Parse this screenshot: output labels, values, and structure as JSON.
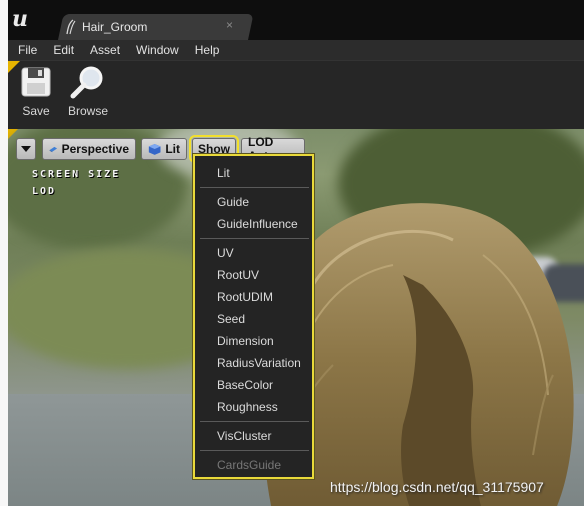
{
  "app": {
    "logo_icon": "unreal-logo-icon"
  },
  "tab": {
    "title": "Hair_Groom",
    "close_glyph": "×",
    "icon": "groom-asset-icon"
  },
  "menu": [
    "File",
    "Edit",
    "Asset",
    "Window",
    "Help"
  ],
  "toolbar": {
    "save_label": "Save",
    "browse_label": "Browse"
  },
  "viewport_toolbar": {
    "perspective_label": "Perspective",
    "lit_label": "Lit",
    "show_label": "Show",
    "lod_label": "LOD Auto"
  },
  "overlay": {
    "line1": "SCREEN SIZE",
    "line2": "LOD"
  },
  "show_menu": {
    "items": [
      "Lit",
      "Guide",
      "GuideInfluence",
      "UV",
      "RootUV",
      "RootUDIM",
      "Seed",
      "Dimension",
      "RadiusVariation",
      "BaseColor",
      "Roughness",
      "VisCluster",
      "CardsGuide"
    ],
    "disabled_item": "CardsGuide"
  },
  "watermark": "https://blog.csdn.net/qq_31175907",
  "colors": {
    "highlight": "#e9d93a",
    "accent": "#e6b400",
    "menu_bg": "#242424"
  }
}
